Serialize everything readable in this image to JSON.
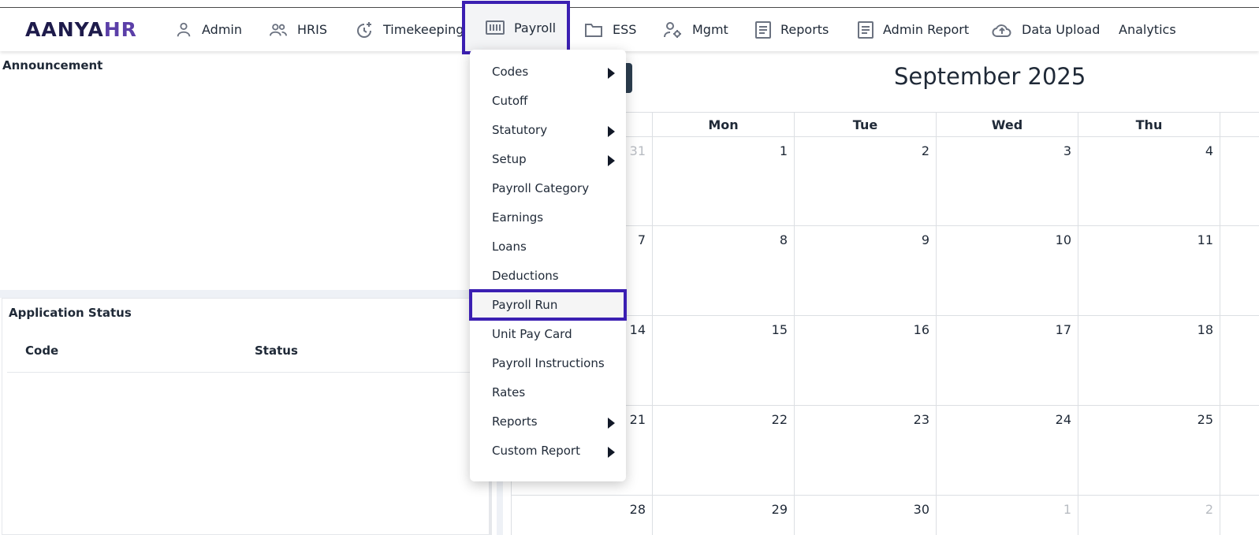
{
  "brand": {
    "logo_part1": "AANYA",
    "logo_part2": "HR"
  },
  "nav": {
    "admin": "Admin",
    "hris": "HRIS",
    "timekeeping": "Timekeeping",
    "payroll": "Payroll",
    "ess": "ESS",
    "mgmt": "Mgmt",
    "reports": "Reports",
    "admin_report": "Admin Report",
    "data_upload": "Data Upload",
    "analytics": "Analytics"
  },
  "payroll_menu": {
    "items": [
      {
        "label": "Codes",
        "submenu": true
      },
      {
        "label": "Cutoff",
        "submenu": false
      },
      {
        "label": "Statutory",
        "submenu": true
      },
      {
        "label": "Setup",
        "submenu": true
      },
      {
        "label": "Payroll Category",
        "submenu": false
      },
      {
        "label": "Earnings",
        "submenu": false
      },
      {
        "label": "Loans",
        "submenu": false
      },
      {
        "label": "Deductions",
        "submenu": false
      },
      {
        "label": "Payroll Run",
        "submenu": false,
        "highlighted": true
      },
      {
        "label": "Unit Pay Card",
        "submenu": false
      },
      {
        "label": "Payroll Instructions",
        "submenu": false
      },
      {
        "label": "Rates",
        "submenu": false
      },
      {
        "label": "Reports",
        "submenu": true
      },
      {
        "label": "Custom Report",
        "submenu": true
      }
    ]
  },
  "announcement": {
    "title": "Announcement"
  },
  "application_status": {
    "title": "Application Status",
    "col_code": "Code",
    "col_status": "Status"
  },
  "calendar": {
    "title": "September 2025",
    "weekdays": [
      "Mon",
      "Tue",
      "Wed",
      "Thu"
    ],
    "weeks": [
      [
        "31",
        "1",
        "2",
        "3",
        "4"
      ],
      [
        "7",
        "8",
        "9",
        "10",
        "11"
      ],
      [
        "14",
        "15",
        "16",
        "17",
        "18"
      ],
      [
        "21",
        "22",
        "23",
        "24",
        "25"
      ],
      [
        "28",
        "29",
        "30",
        "1",
        "2"
      ]
    ]
  },
  "colors": {
    "accent": "#3b1fb2",
    "brand_dark": "#1e1b4b",
    "brand_purple": "#5b3fa8"
  }
}
